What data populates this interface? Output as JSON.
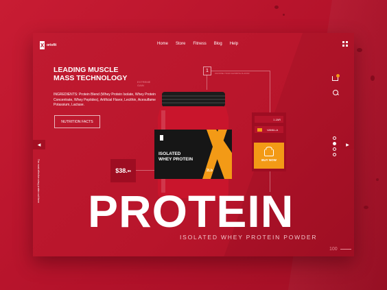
{
  "brand": {
    "name": "oriofit",
    "mark": "X"
  },
  "nav": {
    "items": [
      "Home",
      "Store",
      "Fitness",
      "Blog",
      "Help"
    ]
  },
  "hero": {
    "headline_line1": "LEADING MUSCLE",
    "headline_line2": "MASS TECHNOLOGY",
    "tag_line1": "EXTREME",
    "tag_line2": "GAIN",
    "ingredients": "INGREDIENTS: Protein Blend (Whey Protein Isolate, Whey Protein Concentrate, Whey Peptides), Artificial Flavor, Lecithin, Acesulfame Potassium, Lactase.",
    "button_label": "NUTRITION FACTS",
    "vertical_text": "The most effective whey protein out there"
  },
  "product": {
    "jar_brand": "X",
    "jar_line1": "ISOLATED",
    "jar_line2": "WHEY PROTEIN",
    "jar_weight": "2Lb",
    "price_main": "$38.",
    "price_cents": "99",
    "step": "1",
    "step_label": "CHOOSE YOUR FAVORITE FLAVOR",
    "options": [
      "1 JAR",
      "VANILLA"
    ],
    "buy_label": "BUY NOW"
  },
  "big_title": "PROTEIN",
  "subtitle": "ISOLATED WHEY PROTEIN POWDER",
  "page_number": "100",
  "arrows": {
    "left": "◀",
    "right": "▶"
  },
  "colors": {
    "accent": "#b5142b",
    "orange": "#f39a16",
    "dark": "#1a1a1a"
  }
}
